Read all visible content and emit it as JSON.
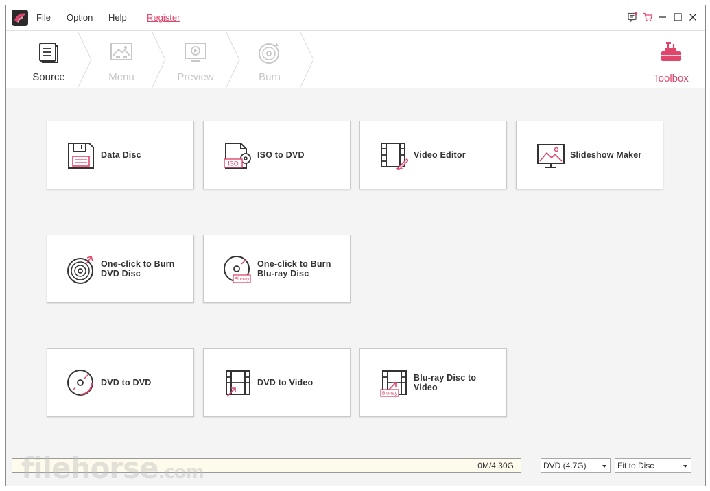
{
  "menu": {
    "file": "File",
    "option": "Option",
    "help": "Help",
    "register": "Register"
  },
  "steps": [
    {
      "label": "Source",
      "active": true
    },
    {
      "label": "Menu",
      "active": false
    },
    {
      "label": "Preview",
      "active": false
    },
    {
      "label": "Burn",
      "active": false
    }
  ],
  "toolbox": {
    "label": "Toolbox"
  },
  "tools": [
    {
      "label": "Data Disc"
    },
    {
      "label": "ISO to DVD"
    },
    {
      "label": "Video Editor"
    },
    {
      "label": "Slideshow Maker"
    },
    {
      "label": "One-click to Burn DVD Disc"
    },
    {
      "label": "One-click to Burn Blu-ray Disc"
    },
    {
      "label": "DVD to DVD"
    },
    {
      "label": "DVD to Video"
    },
    {
      "label": "Blu-ray Disc to Video"
    }
  ],
  "icon_badges": {
    "iso": "ISO",
    "bluray": "Blu-ray"
  },
  "status": {
    "size_text": "0M/4.30G",
    "disc_type": "DVD (4.7G)",
    "fit_mode": "Fit to Disc"
  },
  "watermark": {
    "main": "filehorse",
    "suffix": ".com"
  },
  "colors": {
    "accent": "#e0466b",
    "inactive": "#c7c7c7",
    "background": "#f4f4f4"
  }
}
